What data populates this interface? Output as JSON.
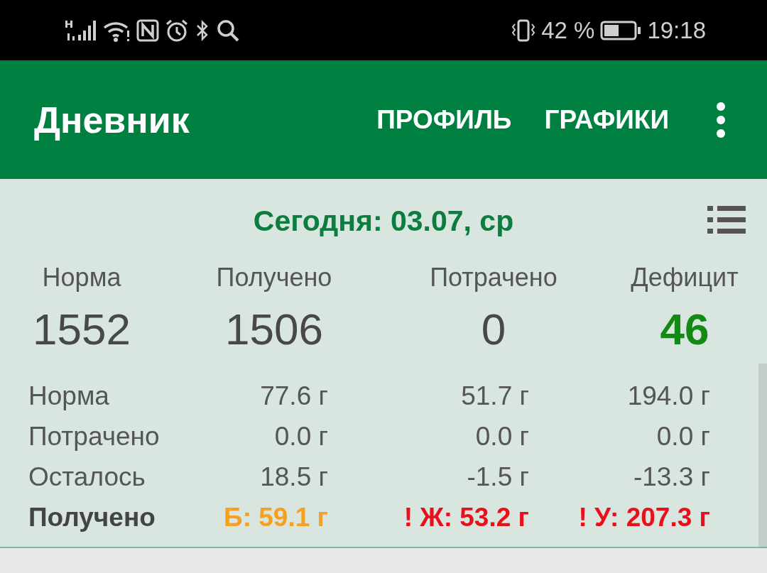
{
  "status_bar": {
    "battery_percent": "42 %",
    "time": "19:18"
  },
  "app_bar": {
    "title": "Дневник",
    "actions": [
      "ПРОФИЛЬ",
      "ГРАФИКИ"
    ]
  },
  "date_header": "Сегодня: 03.07, ср",
  "totals": [
    {
      "label": "Норма",
      "value": "1552",
      "highlight": false
    },
    {
      "label": "Получено",
      "value": "1506",
      "highlight": false
    },
    {
      "label": "Потрачено",
      "value": "0",
      "highlight": false
    },
    {
      "label": "Дефицит",
      "value": "46",
      "highlight": true
    }
  ],
  "macros": [
    {
      "label": "Норма",
      "bold": false,
      "cells": [
        {
          "text": "77.6 г"
        },
        {
          "text": "51.7 г"
        },
        {
          "text": "194.0 г"
        }
      ]
    },
    {
      "label": "Потрачено",
      "bold": false,
      "cells": [
        {
          "text": "0.0 г"
        },
        {
          "text": "0.0 г"
        },
        {
          "text": "0.0 г"
        }
      ]
    },
    {
      "label": "Осталось",
      "bold": false,
      "cells": [
        {
          "text": "18.5 г"
        },
        {
          "text": "-1.5 г"
        },
        {
          "text": "-13.3 г"
        }
      ]
    },
    {
      "label": "Получено",
      "bold": true,
      "cells": [
        {
          "text": "Б: 59.1 г",
          "color": "#f5a01e"
        },
        {
          "text": "! Ж: 53.2 г",
          "color": "#e8101a"
        },
        {
          "text": "! У: 207.3 г",
          "color": "#e8101a"
        }
      ]
    }
  ]
}
